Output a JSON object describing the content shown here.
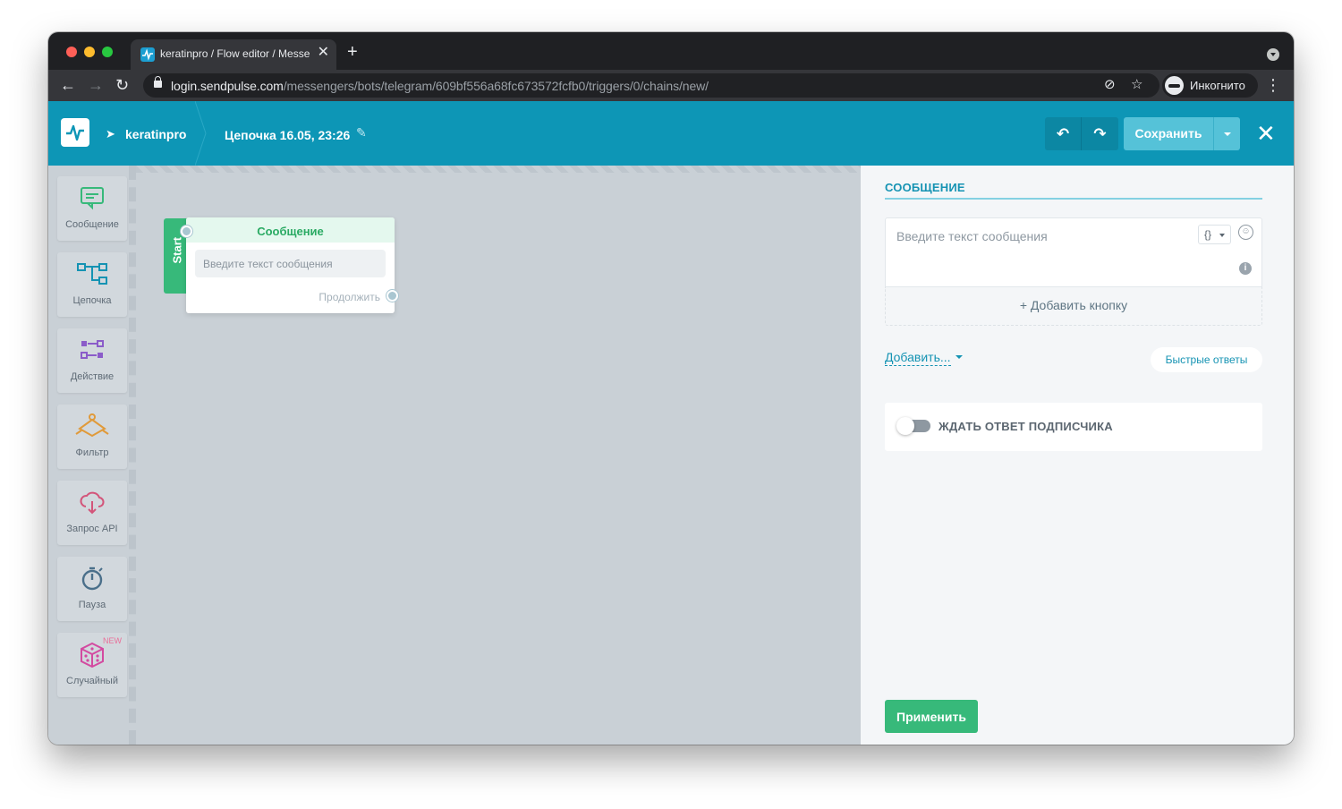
{
  "browser": {
    "tab_title": "keratinpro / Flow editor / Messe",
    "tab_close": "✕",
    "new_tab": "+",
    "url_host": "login.sendpulse.com",
    "url_path": "/messengers/bots/telegram/609bf556a68fc673572fcfb0/triggers/0/chains/new/",
    "profile_label": "Инкогнито",
    "nav_back": "←",
    "nav_forward": "→",
    "nav_reload": "↻",
    "eye_off_icon": "⊘",
    "star_icon": "☆",
    "menu_icon": "⋮"
  },
  "header": {
    "bot_name": "keratinpro",
    "chain_title": "Цепочка 16.05, 23:26",
    "edit_glyph": "✎",
    "undo_glyph": "↶",
    "redo_glyph": "↷",
    "save_label": "Сохранить",
    "close_glyph": "✕",
    "telegram_glyph": "➤"
  },
  "sidebar": {
    "items": [
      {
        "label": "Сообщение",
        "icon": "message-icon",
        "glyph": "▭",
        "color": "#37b97a"
      },
      {
        "label": "Цепочка",
        "icon": "chain-icon",
        "glyph": "⊞",
        "color": "#1593b3"
      },
      {
        "label": "Действие",
        "icon": "action-icon",
        "glyph": "⇄",
        "color": "#8b5cc9"
      },
      {
        "label": "Фильтр",
        "icon": "filter-icon",
        "glyph": "◇",
        "color": "#e09a3a"
      },
      {
        "label": "Запрос API",
        "icon": "api-icon",
        "glyph": "☁",
        "color": "#d3557a"
      },
      {
        "label": "Пауза",
        "icon": "timer-icon",
        "glyph": "◷",
        "color": "#4a6f8a"
      },
      {
        "label": "Случайный",
        "icon": "dice-icon",
        "glyph": "⬡",
        "color": "#d34aa0",
        "badge": "NEW"
      }
    ]
  },
  "canvas": {
    "start_label": "Start",
    "node": {
      "title": "Сообщение",
      "text_placeholder": "Введите текст сообщения",
      "continue_label": "Продолжить"
    }
  },
  "panel": {
    "title": "СООБЩЕНИЕ",
    "message_placeholder": "Введите текст сообщения",
    "variables_glyph": "{}",
    "emoji_glyph": "☺",
    "info_glyph": "i",
    "add_button_label": "+ Добавить кнопку",
    "add_more_label": "Добавить...",
    "quick_replies_label": "Быстрые ответы",
    "wait_reply_label": "ЖДАТЬ ОТВЕТ ПОДПИСЧИКА",
    "wait_reply_enabled": false,
    "apply_label": "Применить"
  },
  "colors": {
    "header_bg": "#0d96b6",
    "accent": "#1593b3",
    "primary_green": "#37b97a",
    "save_button": "#55c2d8"
  }
}
